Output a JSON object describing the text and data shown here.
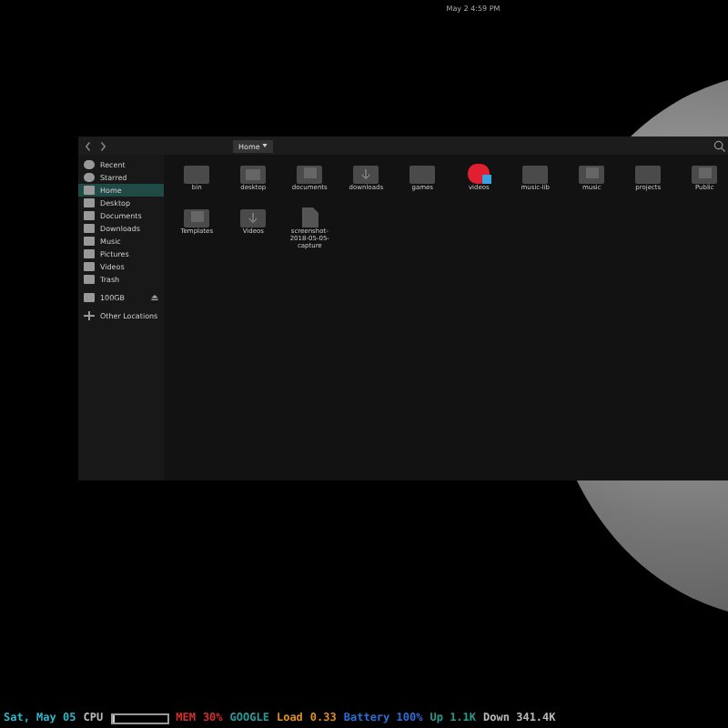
{
  "top_bar": {
    "clock": "May 2  4:59 PM"
  },
  "file_manager": {
    "path_button": "Home",
    "sidebar": [
      {
        "label": "Recent",
        "kind": "round",
        "selected": false
      },
      {
        "label": "Starred",
        "kind": "round",
        "selected": false
      },
      {
        "label": "Home",
        "kind": "folder",
        "selected": true
      },
      {
        "label": "Desktop",
        "kind": "folder",
        "selected": false
      },
      {
        "label": "Documents",
        "kind": "folder",
        "selected": false
      },
      {
        "label": "Downloads",
        "kind": "folder",
        "selected": false
      },
      {
        "label": "Music",
        "kind": "folder",
        "selected": false
      },
      {
        "label": "Pictures",
        "kind": "folder",
        "selected": false
      },
      {
        "label": "Videos",
        "kind": "folder",
        "selected": false
      },
      {
        "label": "Trash",
        "kind": "folder",
        "selected": false
      },
      {
        "label": "100GB",
        "kind": "drive",
        "selected": false
      },
      {
        "label": "Other Locations",
        "kind": "plus",
        "selected": false
      }
    ],
    "files": [
      {
        "name": "bin",
        "kind": "folder"
      },
      {
        "name": "desktop",
        "kind": "grid"
      },
      {
        "name": "documents",
        "kind": "docs"
      },
      {
        "name": "downloads",
        "kind": "download"
      },
      {
        "name": "games",
        "kind": "folder"
      },
      {
        "name": "videos",
        "kind": "app"
      },
      {
        "name": "music-lib",
        "kind": "folder"
      },
      {
        "name": "music",
        "kind": "docs"
      },
      {
        "name": "projects",
        "kind": "folder"
      },
      {
        "name": "Public",
        "kind": "docs"
      },
      {
        "name": "Templates",
        "kind": "docs"
      },
      {
        "name": "Videos",
        "kind": "download"
      },
      {
        "name": "screenshot-2018-05-05-capture",
        "kind": "file"
      }
    ]
  },
  "status_bar": [
    {
      "text": "Sat, May 05",
      "color": "#2fb8c8"
    },
    {
      "text": "CPU",
      "color": "#bbbbbb",
      "level": 0.05
    },
    {
      "text": "MEM",
      "color": "#d83030"
    },
    {
      "text": "30%",
      "color": "#d83030"
    },
    {
      "text": "GOOGLE",
      "color": "#2a9a9a"
    },
    {
      "text": "Load",
      "color": "#e09020"
    },
    {
      "text": "0.33",
      "color": "#e09020"
    },
    {
      "text": "Battery 100%",
      "color": "#2f6fd8"
    },
    {
      "text": "Up 1.1K",
      "color": "#2a9a8a"
    },
    {
      "text": "Down 341.4K",
      "color": "#bbbbbb"
    }
  ]
}
